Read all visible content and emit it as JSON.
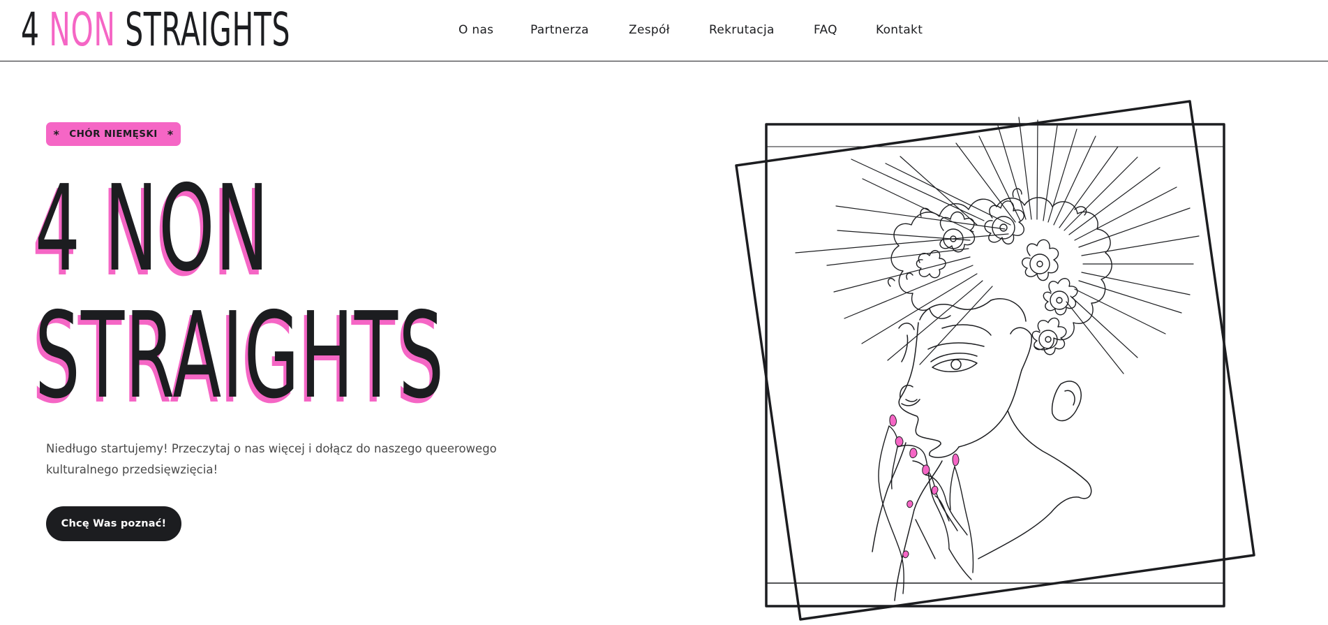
{
  "header": {
    "logo": {
      "part1": "4 ",
      "part2": "NON",
      "part3": " STRAIGHTS"
    },
    "nav": [
      {
        "label": "O nas"
      },
      {
        "label": "Partnerza"
      },
      {
        "label": "Zespół"
      },
      {
        "label": "Rekrutacja"
      },
      {
        "label": "FAQ"
      },
      {
        "label": "Kontakt"
      }
    ]
  },
  "hero": {
    "badge": {
      "star_left": "*",
      "label": "CHÓR NIEMĘSKI",
      "star_right": "*"
    },
    "title_line1": "4 NON",
    "title_line2": "STRAIGHTS",
    "description": "Niedługo startujemy! Przeczytaj o nas więcej i dołącz do naszego queerowego kulturalnego przedsięwzięcia!",
    "cta_label": "Chcę Was poznać!"
  },
  "colors": {
    "accent": "#f566c5",
    "ink": "#1c1d20",
    "text_muted": "#4a4a4a",
    "background": "#ffffff"
  },
  "illustration": {
    "icon": "woman-with-flower-crown-line-art-icon"
  }
}
